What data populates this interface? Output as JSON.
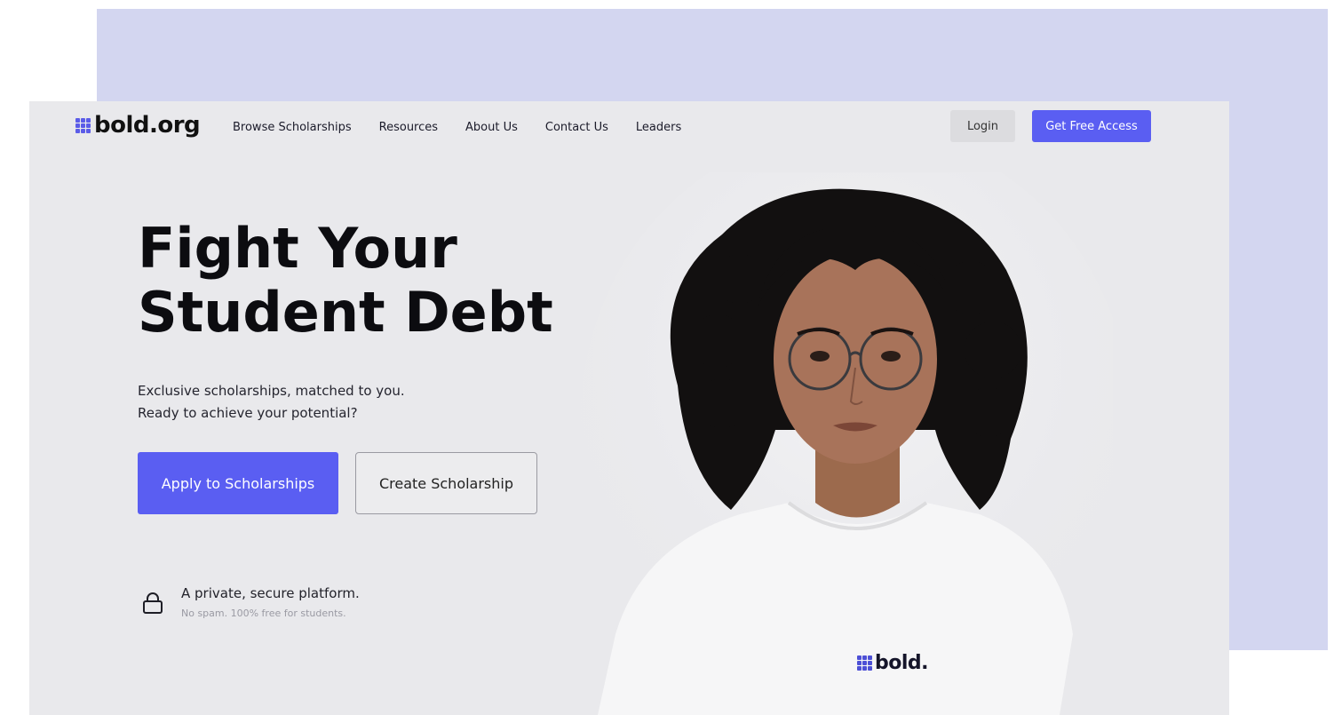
{
  "brand": {
    "name": "bold.org",
    "shirt_name": "bold."
  },
  "nav": {
    "items": [
      "Browse Scholarships",
      "Resources",
      "About Us",
      "Contact Us",
      "Leaders"
    ]
  },
  "header": {
    "login_label": "Login",
    "cta_label": "Get Free Access"
  },
  "hero": {
    "headline_line1": "Fight Your",
    "headline_line2": "Student Debt",
    "sub_line1": "Exclusive scholarships, matched to you.",
    "sub_line2": "Ready to achieve your potential?",
    "apply_label": "Apply to Scholarships",
    "create_label": "Create Scholarship"
  },
  "security": {
    "icon": "lock-icon",
    "title": "A private, secure platform.",
    "subtitle": "No spam. 100% free for students."
  },
  "colors": {
    "accent": "#5a5ef2",
    "background_panel": "#d3d6f0",
    "page_background": "#e9e9ec"
  }
}
